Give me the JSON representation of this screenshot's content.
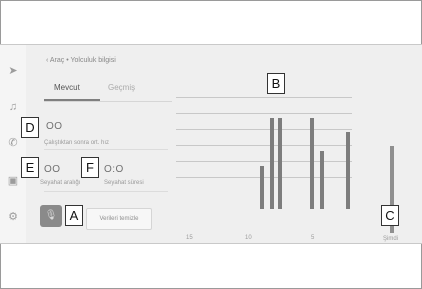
{
  "breadcrumb": "‹  Araç • Yolculuk bilgisi",
  "tabs": [
    {
      "label": "Mevcut",
      "active": true
    },
    {
      "label": "Geçmiş",
      "active": false
    }
  ],
  "metrics": {
    "avg_speed": {
      "value": "OO",
      "label": "Çalıştıktan sonra ort. hız"
    },
    "distance": {
      "value": "OO",
      "label": "Seyahat aralığı"
    },
    "time": {
      "value": "O:O",
      "label": "Seyahat süresi"
    }
  },
  "reset_button": "Verileri temizle",
  "callouts": {
    "A": "A",
    "B": "B",
    "C": "C",
    "D": "D",
    "E": "E",
    "F": "F"
  },
  "rail_icons": [
    "navigation-icon",
    "music-icon",
    "phone-icon",
    "car-icon",
    "settings-icon"
  ],
  "chart_data": {
    "type": "bar",
    "x_axis_ticks": [
      "15",
      "10",
      "5"
    ],
    "current_label": "Şimdi",
    "values": [
      0.45,
      0.95,
      0.95,
      0.95,
      0.6,
      0.8,
      0.95
    ],
    "current_level": 0.95,
    "grid": true
  },
  "colors": {
    "screen_bg": "#efefef",
    "bar": "#7d7d7d",
    "accent": "#8a8a8a"
  }
}
